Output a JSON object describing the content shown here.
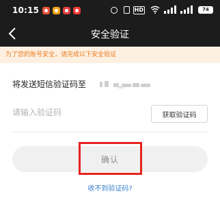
{
  "status_bar": {
    "time": "10:15",
    "battery": "74",
    "hd_label": "HD",
    "icons": [
      "app-icon-1",
      "app-icon-2",
      "app-icon-3",
      "app-icon-4",
      "alarm-icon",
      "vibrate-icon",
      "hd-icon",
      "wifi-icon",
      "signal-icon",
      "signal-icon",
      "battery-icon"
    ]
  },
  "header": {
    "title": "安全验证",
    "back_icon": "chevron-left-icon",
    "background": "#1c1c1c"
  },
  "notice": {
    "text": "为了您的账号安全，请完成以下安全验证",
    "color": "#ec7a1c",
    "background": "#fdf0e1"
  },
  "verification": {
    "send_text": "将发送短信验证码至",
    "phone_masked": true,
    "code_placeholder": "请输入验证码",
    "code_value": "",
    "get_code_label": "获取验证码"
  },
  "confirm": {
    "label": "确认",
    "highlight_color": "#e5231f"
  },
  "help": {
    "no_code_link": "收不到验证码?",
    "link_color": "#3a7fcf"
  }
}
